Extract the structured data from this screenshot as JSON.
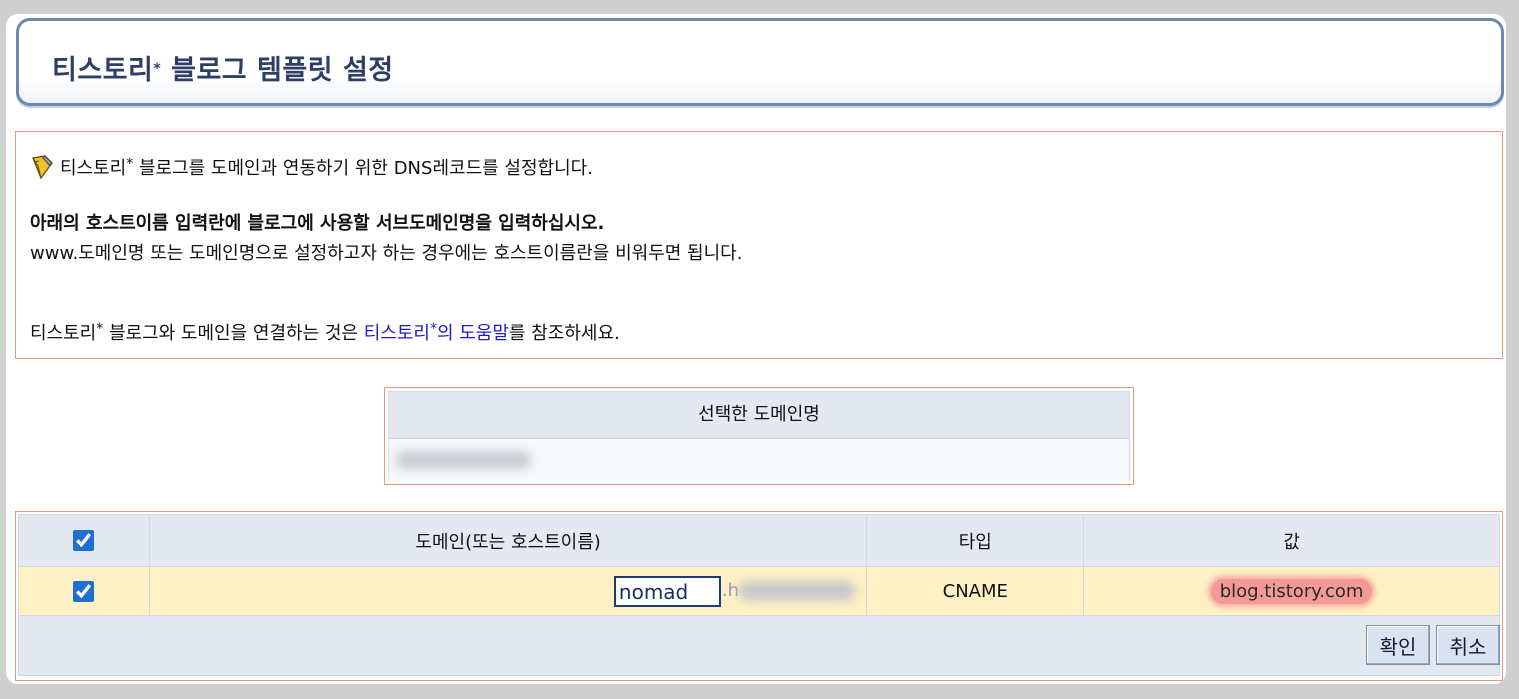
{
  "header": {
    "title_main": "티스토리",
    "title_star": "*",
    "title_rest": " 블로그 템플릿 설정"
  },
  "info": {
    "line1_a": "티스토리",
    "line1_star": "*",
    "line1_b": " 블로그를 도메인과 연동하기 위한 DNS레코드를 설정합니다.",
    "line2": "아래의 호스트이름 입력란에 블로그에 사용할 서브도메인명을 입력하십시오.",
    "line3": "www.도메인명 또는 도메인명으로 설정하고자 하는 경우에는 호스트이름란을 비워두면 됩니다.",
    "line4_a": "티스토리",
    "line4_star": "*",
    "line4_b": " 블로그와 도메인을 연결하는 것은 ",
    "help_link_a": "티스토리",
    "help_link_star": "*",
    "help_link_b": "의 도움말",
    "line4_c": "를 참조하세요."
  },
  "selected_domain": {
    "header": "선택한 도메인명"
  },
  "dns_table": {
    "columns": [
      "",
      "도메인(또는 호스트이름)",
      "타입",
      "값"
    ],
    "header_checked": true,
    "rows": [
      {
        "checked": true,
        "host_value": "nomad",
        "host_suffix": ".h",
        "type": "CNAME",
        "value": "blog.tistory.com"
      }
    ]
  },
  "buttons": {
    "confirm": "확인",
    "cancel": "취소"
  },
  "colors": {
    "title_text": "#2e3f66",
    "border_accent": "#e29b82",
    "link": "#1a1fc7",
    "row_highlight": "#fff1c5",
    "value_highlight": "#f49a95"
  },
  "icons": {
    "info": "pencil-icon"
  }
}
